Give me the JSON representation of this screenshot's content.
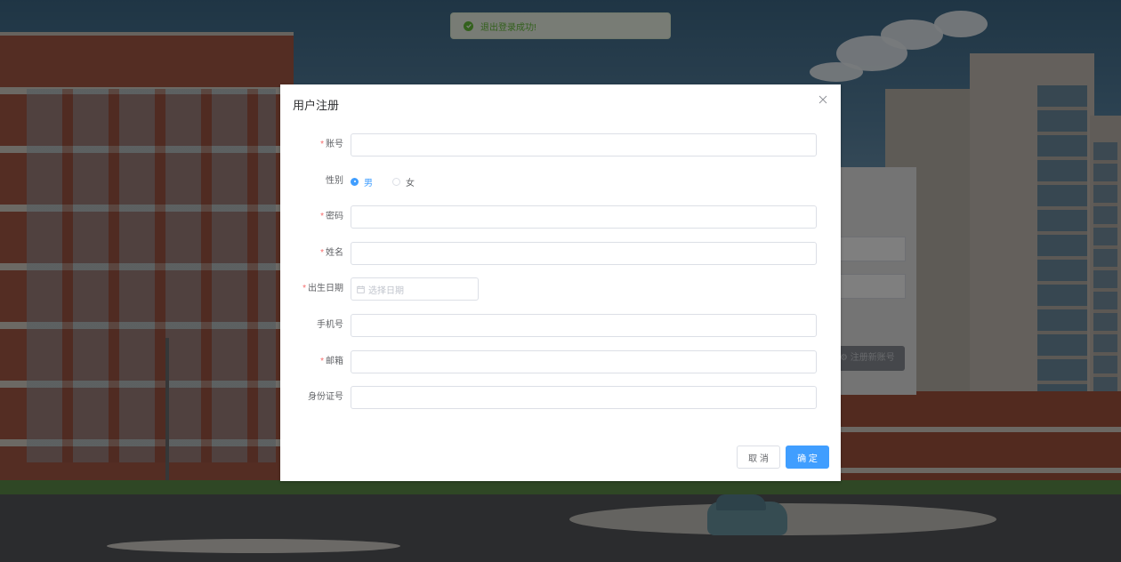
{
  "toast": {
    "message": "退出登录成功!",
    "color": "#67c23a"
  },
  "background": {
    "register_button_label": "注册新账号"
  },
  "dialog": {
    "title": "用户注册",
    "close_icon": "close-icon",
    "fields": {
      "account": {
        "label": "账号",
        "required": true,
        "value": ""
      },
      "gender": {
        "label": "性别",
        "options": [
          "男",
          "女"
        ],
        "selected": "男"
      },
      "password": {
        "label": "密码",
        "required": true,
        "value": ""
      },
      "name": {
        "label": "姓名",
        "required": true,
        "value": ""
      },
      "birthdate": {
        "label": "出生日期",
        "required": true,
        "placeholder": "选择日期",
        "icon": "calendar-icon"
      },
      "phone": {
        "label": "手机号",
        "required": false,
        "value": ""
      },
      "email": {
        "label": "邮箱",
        "required": true,
        "value": ""
      },
      "id_card": {
        "label": "身份证号",
        "required": false,
        "value": ""
      }
    },
    "buttons": {
      "cancel": "取 消",
      "confirm": "确 定"
    },
    "accent_color": "#409eff",
    "required_color": "#f56c6c"
  }
}
